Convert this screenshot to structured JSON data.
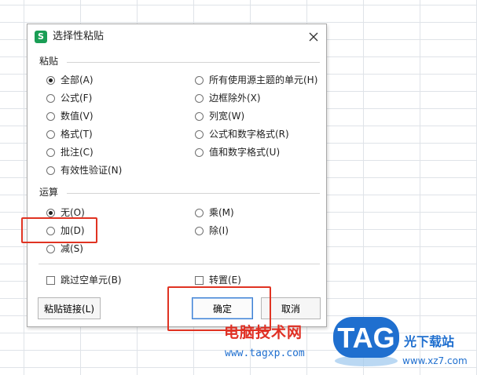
{
  "dialog": {
    "app_icon": "S",
    "title": "选择性粘贴",
    "close_icon": "close-icon"
  },
  "paste_section": {
    "label": "粘贴",
    "options": [
      {
        "label": "全部(A)",
        "checked": true
      },
      {
        "label": "公式(F)",
        "checked": false
      },
      {
        "label": "数值(V)",
        "checked": false
      },
      {
        "label": "格式(T)",
        "checked": false
      },
      {
        "label": "批注(C)",
        "checked": false
      },
      {
        "label": "有效性验证(N)",
        "checked": false
      },
      {
        "label": "所有使用源主题的单元(H)",
        "checked": false
      },
      {
        "label": "边框除外(X)",
        "checked": false
      },
      {
        "label": "列宽(W)",
        "checked": false
      },
      {
        "label": "公式和数字格式(R)",
        "checked": false
      },
      {
        "label": "值和数字格式(U)",
        "checked": false
      }
    ]
  },
  "operation_section": {
    "label": "运算",
    "options": [
      {
        "label": "无(O)",
        "checked": true
      },
      {
        "label": "加(D)",
        "checked": false
      },
      {
        "label": "减(S)",
        "checked": false
      },
      {
        "label": "乘(M)",
        "checked": false
      },
      {
        "label": "除(I)",
        "checked": false
      }
    ]
  },
  "checkboxes": {
    "skip_blanks": {
      "label": "跳过空单元(B)",
      "checked": false
    },
    "transpose": {
      "label": "转置(E)",
      "checked": false
    }
  },
  "buttons": {
    "paste_link": "粘贴链接(L)",
    "ok": "确定",
    "cancel": "取消"
  },
  "watermark": {
    "text": "电脑技术网",
    "url": "www.tagxp.com",
    "logo_text": "TAG",
    "brand": "光下载站",
    "brand_url": "www.xz7.com"
  },
  "colors": {
    "highlight": "#e03322",
    "primary_border": "#3c7fd3",
    "logo_blue": "#1f6fcf"
  }
}
